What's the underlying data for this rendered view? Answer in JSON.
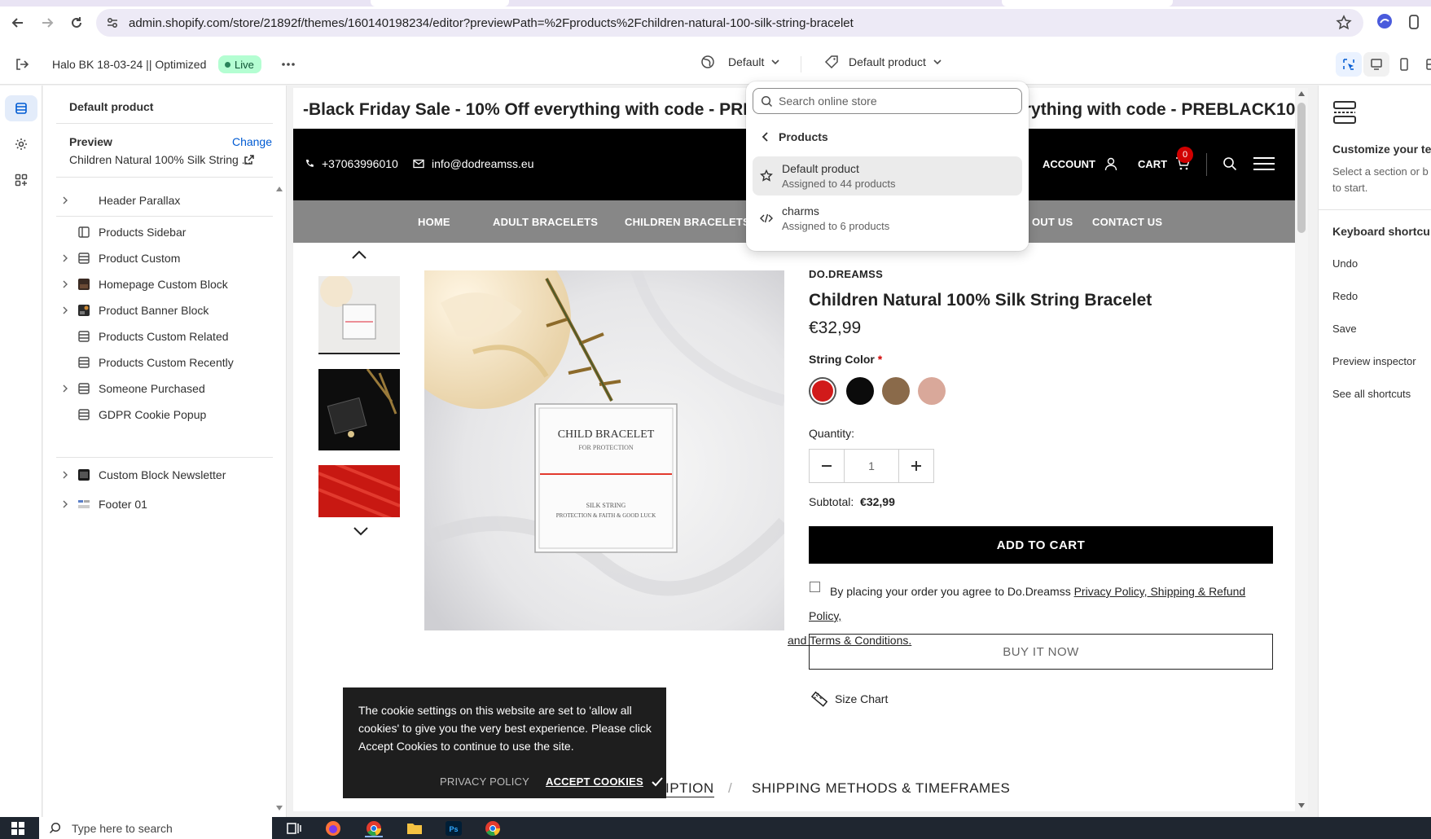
{
  "browser": {
    "url": "admin.shopify.com/store/21892f/themes/160140198234/editor?previewPath=%2Fproducts%2Fchildren-natural-100-silk-string-bracelet"
  },
  "editor": {
    "store_name": "Halo BK 18-03-24 || Optimized",
    "live_label": "Live",
    "theme_dropdown": "Default",
    "template_dropdown": "Default product"
  },
  "sidebar": {
    "title": "Default product",
    "preview_label": "Preview",
    "change_label": "Change",
    "preview_value": "Children Natural 100% Silk String ...",
    "items": [
      {
        "label": "Header Parallax"
      },
      {
        "label": "Products Sidebar"
      },
      {
        "label": "Product Custom"
      },
      {
        "label": "Homepage Custom Block"
      },
      {
        "label": "Product Banner Block"
      },
      {
        "label": "Products Custom Related"
      },
      {
        "label": "Products Custom Recently"
      },
      {
        "label": "Someone Purchased"
      },
      {
        "label": "GDPR Cookie Popup"
      },
      {
        "label": "Custom Block Newsletter"
      },
      {
        "label": "Footer 01"
      }
    ]
  },
  "popover": {
    "search_placeholder": "Search online store",
    "back_label": "Products",
    "options": [
      {
        "name": "Default product",
        "sub": "Assigned to 44 products"
      },
      {
        "name": "charms",
        "sub": "Assigned to 6 products"
      }
    ]
  },
  "store": {
    "marquee_1": "-Black Friday Sale - 10% Off everything with code - PREBLA",
    "marquee_2": "f everything with code - PREBLACK10",
    "phone": "+37063996010",
    "email": "info@dodreamss.eu",
    "account_label": "ACCOUNT",
    "cart_label": "CART",
    "cart_count": "0",
    "nav": [
      "HOME",
      "ADULT BRACELETS",
      "CHILDREN BRACELETS",
      "OUT US",
      "CONTACT US"
    ]
  },
  "product": {
    "brand": "DO.DREAMSS",
    "title": "Children Natural 100% Silk String Bracelet",
    "price": "€32,99",
    "color_label": "String Color",
    "required_mark": "*",
    "swatches": [
      "#d11a1a",
      "#0b0b0b",
      "#8a6a4a",
      "#d9a89a"
    ],
    "quantity_label": "Quantity:",
    "quantity_value": "1",
    "subtotal_label": "Subtotal:",
    "subtotal_value": "€32,99",
    "add_to_cart": "ADD TO CART",
    "agree_text": "By placing your order you agree to Do.Dreamss",
    "agree_link1": "Privacy Policy, Shipping & Refund Policy,",
    "agree_link2": "and Terms & Conditions.",
    "buy_now": "BUY IT NOW",
    "size_chart": "Size Chart",
    "tab_description": "DESCRIPTION",
    "tab_sep": "/",
    "tab_shipping": "SHIPPING METHODS & TIMEFRAMES",
    "card_title": "CHILD BRACELET",
    "card_sub": "FOR PROTECTION",
    "card_line1": "SILK STRING",
    "card_line2": "PROTECTION & FAITH & GOOD LUCK"
  },
  "cookie": {
    "text": "The cookie settings on this website are set to 'allow all cookies' to give you the very best experience. Please click Accept Cookies to continue to use the site.",
    "privacy": "PRIVACY POLICY",
    "accept": "ACCEPT COOKIES"
  },
  "right_panel": {
    "title": "Customize your te",
    "desc": "Select a section or b sidebar to start.",
    "shortcuts_title": "Keyboard shortcu",
    "shortcuts": [
      "Undo",
      "Redo",
      "Save",
      "Preview inspector",
      "See all shortcuts"
    ]
  },
  "taskbar": {
    "search_placeholder": "Type here to search"
  },
  "colors": {
    "accent": "#005bd3",
    "live_bg": "#b4fed2",
    "cart_badge": "#d10000",
    "nav_bg": "#878787"
  }
}
